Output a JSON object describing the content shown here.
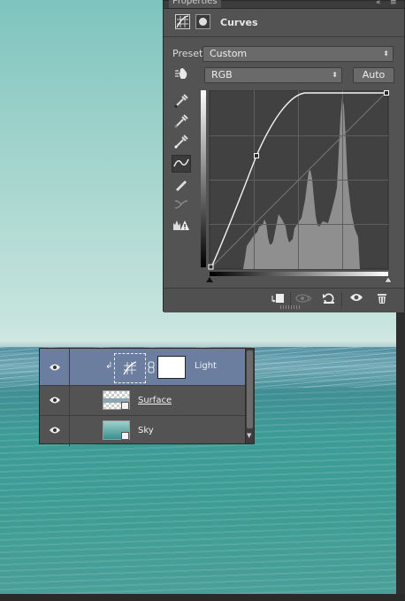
{
  "properties": {
    "tab_label": "Properties",
    "tab_close": "«",
    "tab_menu": "≡",
    "title": "Curves",
    "preset_label": "Preset:",
    "preset_value": "Custom",
    "channel_value": "RGB",
    "auto_label": "Auto"
  },
  "layers": {
    "rows": [
      {
        "name": "Light",
        "selected": true
      },
      {
        "name": "Surface",
        "selected": false
      },
      {
        "name": "Sky",
        "selected": false
      }
    ]
  },
  "colors": {
    "panel": "#535353",
    "selected_layer": "#6b7ea0",
    "histogram": "#8f8f8f"
  }
}
